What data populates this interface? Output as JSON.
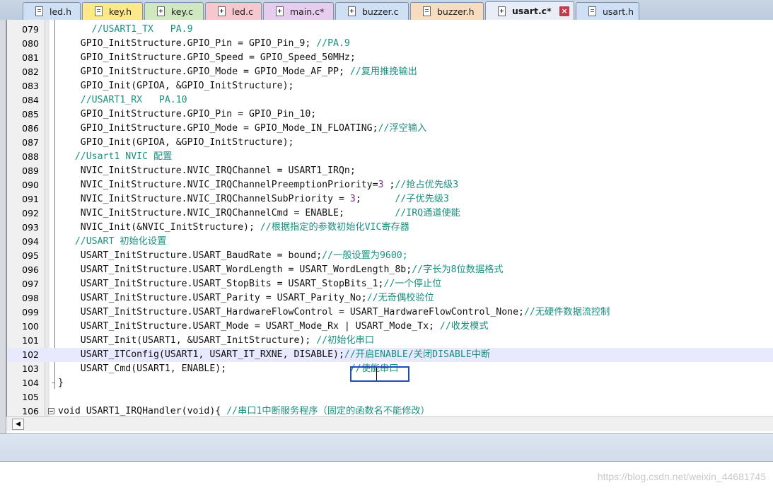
{
  "tabs": [
    {
      "label": "led.h",
      "type": "h",
      "bg": "#cfe0f5"
    },
    {
      "label": "key.h",
      "type": "h",
      "bg": "#fde98a"
    },
    {
      "label": "key.c",
      "type": "c",
      "bg": "#cfe8c0"
    },
    {
      "label": "led.c",
      "type": "c",
      "bg": "#f6c7cc"
    },
    {
      "label": "main.c*",
      "type": "c",
      "bg": "#e6cdee"
    },
    {
      "label": "buzzer.c",
      "type": "c",
      "bg": "#cfe0f5"
    },
    {
      "label": "buzzer.h",
      "type": "h",
      "bg": "#f8dcc0"
    },
    {
      "label": "usart.c*",
      "type": "c",
      "bg": "#e8edf6",
      "active": true,
      "close": "×"
    },
    {
      "label": "usart.h",
      "type": "h",
      "bg": "#cfe0f5"
    }
  ],
  "editor": {
    "current_line": "102",
    "lines": [
      {
        "n": "079",
        "parts": [
          [
            "c",
            "    "
          ],
          [
            "cm",
            "  //USART1_TX   PA.9"
          ]
        ]
      },
      {
        "n": "080",
        "parts": [
          [
            "c",
            "    GPIO_InitStructure.GPIO_Pin = GPIO_Pin_9; "
          ],
          [
            "cm",
            "//PA.9"
          ]
        ]
      },
      {
        "n": "081",
        "parts": [
          [
            "c",
            "    GPIO_InitStructure.GPIO_Speed = GPIO_Speed_50MHz;"
          ]
        ]
      },
      {
        "n": "082",
        "parts": [
          [
            "c",
            "    GPIO_InitStructure.GPIO_Mode = GPIO_Mode_AF_PP; "
          ],
          [
            "cm",
            "//复用推挽输出"
          ]
        ]
      },
      {
        "n": "083",
        "parts": [
          [
            "c",
            "    GPIO_Init(GPIOA, &GPIO_InitStructure);"
          ]
        ]
      },
      {
        "n": "084",
        "parts": [
          [
            "c",
            "    "
          ],
          [
            "cm",
            "//USART1_RX   PA.10"
          ]
        ]
      },
      {
        "n": "085",
        "parts": [
          [
            "c",
            "    GPIO_InitStructure.GPIO_Pin = GPIO_Pin_10;"
          ]
        ]
      },
      {
        "n": "086",
        "parts": [
          [
            "c",
            "    GPIO_InitStructure.GPIO_Mode = GPIO_Mode_IN_FLOATING;"
          ],
          [
            "cm",
            "//浮空输入"
          ]
        ]
      },
      {
        "n": "087",
        "parts": [
          [
            "c",
            "    GPIO_Init(GPIOA, &GPIO_InitStructure);"
          ]
        ]
      },
      {
        "n": "088",
        "parts": [
          [
            "c",
            "   "
          ],
          [
            "cm",
            "//Usart1 NVIC 配置"
          ]
        ]
      },
      {
        "n": "089",
        "parts": [
          [
            "c",
            "    NVIC_InitStructure.NVIC_IRQChannel = USART1_IRQn;"
          ]
        ]
      },
      {
        "n": "090",
        "parts": [
          [
            "c",
            "    NVIC_InitStructure.NVIC_IRQChannelPreemptionPriority="
          ],
          [
            "num",
            "3"
          ],
          [
            "c",
            " ;"
          ],
          [
            "cm",
            "//抢占优先级3"
          ]
        ]
      },
      {
        "n": "091",
        "parts": [
          [
            "c",
            "    NVIC_InitStructure.NVIC_IRQChannelSubPriority = "
          ],
          [
            "num",
            "3"
          ],
          [
            "c",
            ";      "
          ],
          [
            "cm",
            "//子优先级3"
          ]
        ]
      },
      {
        "n": "092",
        "parts": [
          [
            "c",
            "    NVIC_InitStructure.NVIC_IRQChannelCmd = ENABLE;         "
          ],
          [
            "cm",
            "//IRQ通道使能"
          ]
        ]
      },
      {
        "n": "093",
        "parts": [
          [
            "c",
            "    NVIC_Init(&NVIC_InitStructure); "
          ],
          [
            "cm",
            "//根据指定的参数初始化VIC寄存器"
          ]
        ]
      },
      {
        "n": "094",
        "parts": [
          [
            "c",
            "   "
          ],
          [
            "cm",
            "//USART 初始化设置"
          ]
        ]
      },
      {
        "n": "095",
        "parts": [
          [
            "c",
            "    USART_InitStructure.USART_BaudRate = bound;"
          ],
          [
            "cm",
            "//一般设置为9600;"
          ]
        ]
      },
      {
        "n": "096",
        "parts": [
          [
            "c",
            "    USART_InitStructure.USART_WordLength = USART_WordLength_8b;"
          ],
          [
            "cm",
            "//字长为8位数据格式"
          ]
        ]
      },
      {
        "n": "097",
        "parts": [
          [
            "c",
            "    USART_InitStructure.USART_StopBits = USART_StopBits_1;"
          ],
          [
            "cm",
            "//一个停止位"
          ]
        ]
      },
      {
        "n": "098",
        "parts": [
          [
            "c",
            "    USART_InitStructure.USART_Parity = USART_Parity_No;"
          ],
          [
            "cm",
            "//无奇偶校验位"
          ]
        ]
      },
      {
        "n": "099",
        "parts": [
          [
            "c",
            "    USART_InitStructure.USART_HardwareFlowControl = USART_HardwareFlowControl_None;"
          ],
          [
            "cm",
            "//无硬件数据流控制"
          ]
        ]
      },
      {
        "n": "100",
        "parts": [
          [
            "c",
            "    USART_InitStructure.USART_Mode = USART_Mode_Rx | USART_Mode_Tx; "
          ],
          [
            "cm",
            "//收发模式"
          ]
        ]
      },
      {
        "n": "101",
        "parts": [
          [
            "c",
            "    USART_Init(USART1, &USART_InitStructure); "
          ],
          [
            "cm",
            "//初始化串口"
          ]
        ]
      },
      {
        "n": "102",
        "parts": [
          [
            "c",
            "    USART_ITConfig(USART1, USART_IT_RXNE, DISABLE);"
          ],
          [
            "cm",
            "//开启ENABLE/关闭DISABLE中断"
          ]
        ]
      },
      {
        "n": "103",
        "parts": [
          [
            "c",
            "    USART_Cmd(USART1, ENABLE);                      "
          ],
          [
            "cm",
            "//使能串口"
          ]
        ]
      },
      {
        "n": "104",
        "parts": [
          [
            "c",
            "}"
          ]
        ]
      },
      {
        "n": "105",
        "parts": [
          [
            "c",
            ""
          ]
        ]
      },
      {
        "n": "106",
        "parts": [
          [
            "c",
            "void USART1_IRQHandler(void){ "
          ],
          [
            "cm",
            "//串口1中断服务程序（固定的函数名不能修改）"
          ]
        ]
      }
    ]
  },
  "scrollbar": {
    "left_arrow": "◀"
  },
  "watermark": "https://blog.csdn.net/weixin_44681745"
}
